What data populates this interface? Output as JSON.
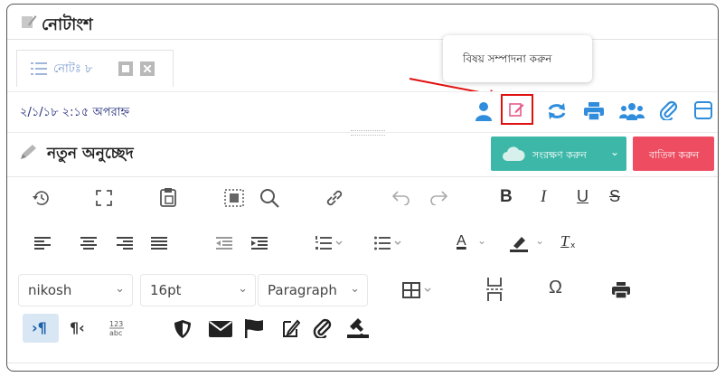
{
  "window_title": "নোটাংশ",
  "tab": {
    "label": "নোটঃ ৮"
  },
  "tooltip": "বিষয় সম্পাদনা করুন",
  "timestamp": "২/১/১৮ ২:১৫ অপরাহ্ন",
  "paragraph_title": "নতুন অনুচ্ছেদ",
  "save_button": "সংরক্ষণ করুন",
  "cancel_button": "বাতিল করুন",
  "font_select": "nikosh",
  "size_select": "16pt",
  "block_select": "Paragraph",
  "toolbar": {
    "bold": "B",
    "italic": "I",
    "underline": "U",
    "strike": "S",
    "font_color": "A",
    "clear_format": "T"
  },
  "colors": {
    "accent_blue": "#2F8DDC",
    "save_green": "#3DB8A8",
    "cancel_red": "#EE4D61",
    "highlight_red": "#E01010",
    "timestamp_navy": "#1E2A78"
  },
  "icons": [
    "note-icon",
    "list-icon",
    "tab-square-icon",
    "tab-close-icon",
    "user-icon",
    "edit-icon",
    "sync-icon",
    "print-icon",
    "users-icon",
    "attachment-icon",
    "panel-icon",
    "pen-icon",
    "cloud-icon",
    "history-icon",
    "fullscreen-icon",
    "paste-icon",
    "select-all-icon",
    "search-icon",
    "link-icon",
    "undo-icon",
    "redo-icon",
    "align-left-icon",
    "align-center-icon",
    "align-right-icon",
    "align-justify-icon",
    "outdent-icon",
    "indent-icon",
    "numbered-list-icon",
    "bullet-list-icon",
    "highlight-icon",
    "table-icon",
    "page-break-icon",
    "omega-icon",
    "print-icon",
    "ltr-icon",
    "rtl-icon",
    "spellcheck-icon",
    "shield-icon",
    "mail-icon",
    "flag-icon",
    "edit-note-icon",
    "paperclip-icon",
    "stamp-icon"
  ]
}
